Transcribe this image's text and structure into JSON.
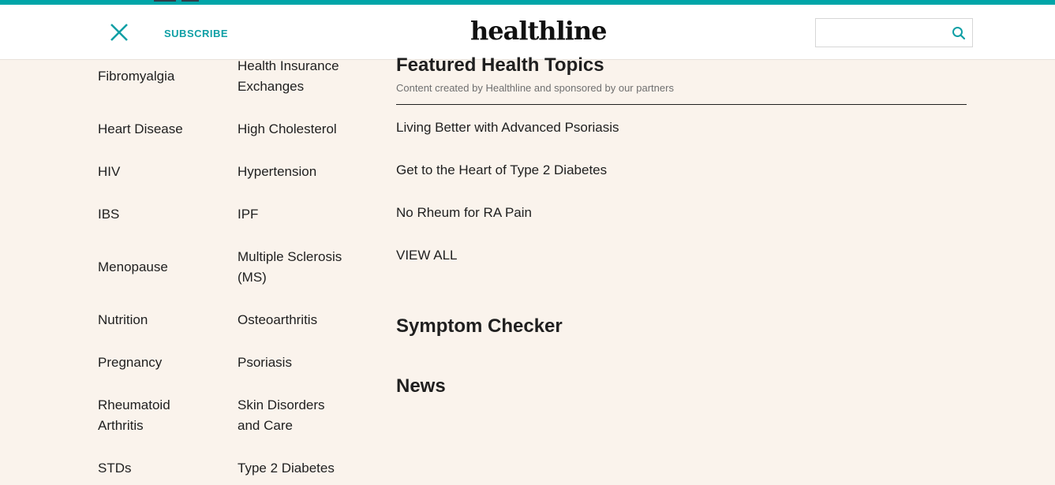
{
  "header": {
    "subscribe_label": "SUBSCRIBE",
    "logo_text": "healthline",
    "search": {
      "value": "",
      "placeholder": ""
    }
  },
  "topics": {
    "column1": [
      "Fibromyalgia",
      "Heart Disease",
      "HIV",
      "IBS",
      "Menopause",
      "Nutrition",
      "Pregnancy",
      "Rheumatoid Arthritis",
      "STDs"
    ],
    "column2": [
      "Health Insurance Exchanges",
      "High Cholesterol",
      "Hypertension",
      "IPF",
      "Multiple Sclerosis (MS)",
      "Osteoarthritis",
      "Psoriasis",
      "Skin Disorders and Care",
      "Type 2 Diabetes"
    ]
  },
  "featured": {
    "title": "Featured Health Topics",
    "subtitle": "Content created by Healthline and sponsored by our partners",
    "links": [
      "Living Better with Advanced Psoriasis",
      "Get to the Heart of Type 2 Diabetes",
      "No Rheum for RA Pain",
      "VIEW ALL"
    ]
  },
  "sections": {
    "symptom_checker": "Symptom Checker",
    "news": "News"
  },
  "colors": {
    "accent": "#00a5a8",
    "background": "#faf3ec",
    "text": "#1f1f1f"
  }
}
